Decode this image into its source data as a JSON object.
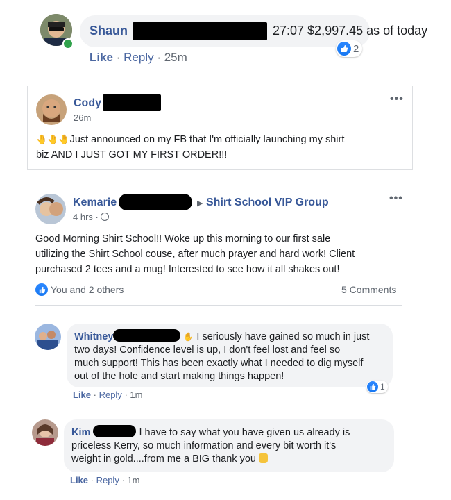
{
  "comment1": {
    "name": "Shaun",
    "text": "27:07 $2,997.45 as of today",
    "like": "Like",
    "reply": "Reply",
    "time": "25m",
    "reaction_count": "2"
  },
  "post1": {
    "name": "Cody",
    "time": "26m",
    "emoji": "🤚🤚🤚",
    "text_line1": "Just announced on my FB that I'm officially launching my shirt",
    "text_line2": "biz AND I JUST GOT MY FIRST ORDER!!!",
    "more": "•••"
  },
  "post2": {
    "name": "Kemarie",
    "group": "Shirt School VIP Group",
    "time": "4 hrs ·",
    "text_line1": "Good Morning Shirt School!! Woke up this morning to our first sale",
    "text_line2": "utilizing the Shirt School couse, after much prayer and hard work! Client",
    "text_line3": "purchased 2 tees and a mug! Interested to see how it all shakes out!",
    "reactions": "You and 2 others",
    "comments": "5 Comments",
    "more": "•••"
  },
  "comment2": {
    "name": "Whitney",
    "text_line1": "I seriously have gained so much in just",
    "text_line2": "two days! Confidence level is up, I don't feel lost and feel so",
    "text_line3": "much support! This has been exactly what I needed to dig myself",
    "text_line4": "out of the hole and start making things happen!",
    "like": "Like",
    "reply": "Reply",
    "time": "1m",
    "reaction_count": "1"
  },
  "comment3": {
    "name": "Kim",
    "text_line1": "I have to say what you have given us already is",
    "text_line2": "priceless Kerry, so much information and every bit worth it's",
    "text_line3": "weight in gold....from me a BIG thank you",
    "like": "Like",
    "reply": "Reply",
    "time": "1m"
  },
  "colors": {
    "name_blue": "#385898",
    "like_blue": "#1778f2",
    "bubble_gray": "#f2f3f5"
  }
}
